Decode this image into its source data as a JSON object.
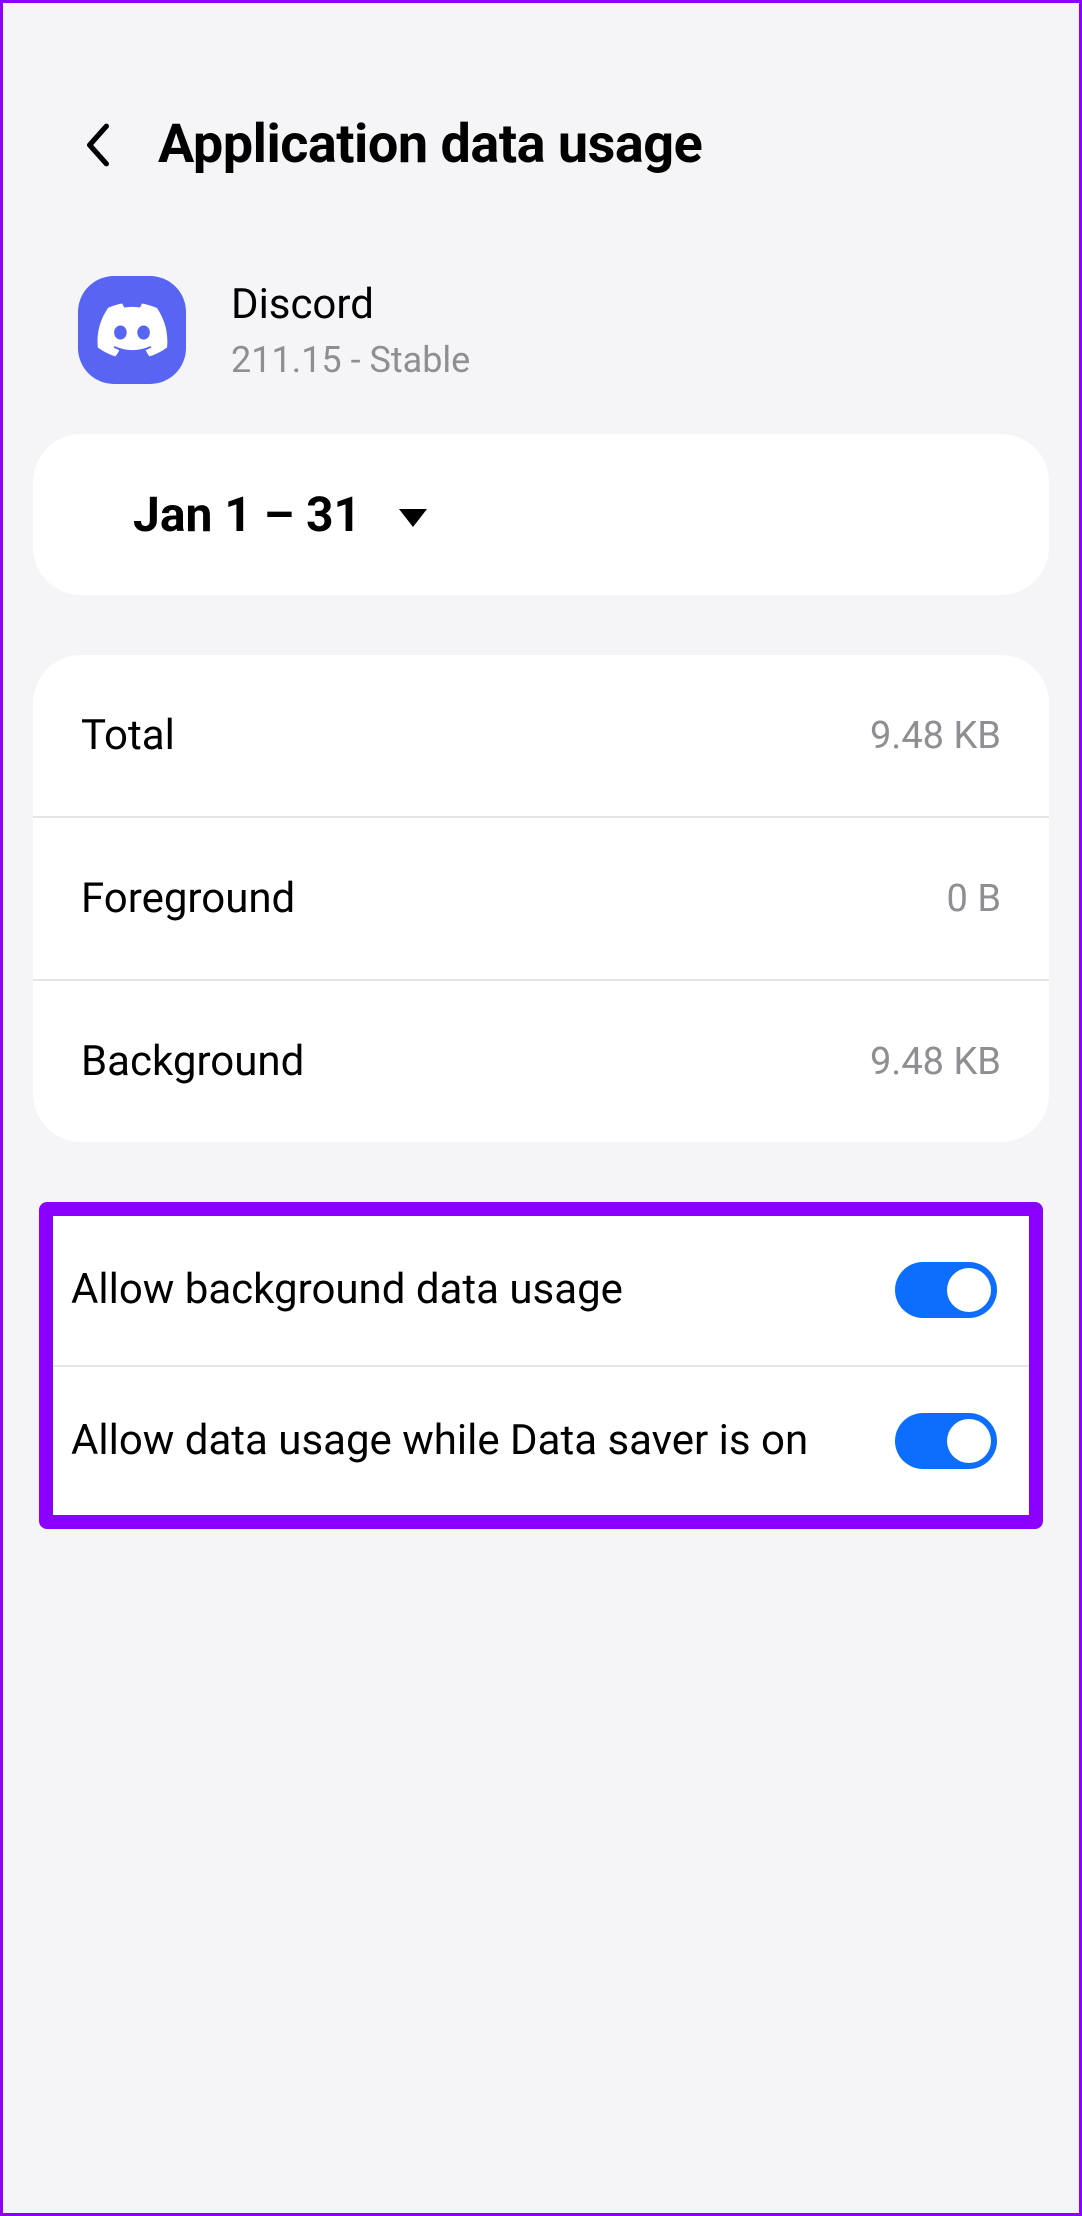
{
  "header": {
    "title": "Application data usage"
  },
  "app": {
    "name": "Discord",
    "version": "211.15 - Stable"
  },
  "dateRange": {
    "label": "Jan 1 – 31"
  },
  "stats": {
    "total": {
      "label": "Total",
      "value": "9.48 KB"
    },
    "foreground": {
      "label": "Foreground",
      "value": "0 B"
    },
    "background": {
      "label": "Background",
      "value": "9.48 KB"
    }
  },
  "toggles": {
    "backgroundData": {
      "label": "Allow background data usage",
      "on": true
    },
    "dataSaver": {
      "label": "Allow data usage while Data saver is on",
      "on": true
    }
  }
}
